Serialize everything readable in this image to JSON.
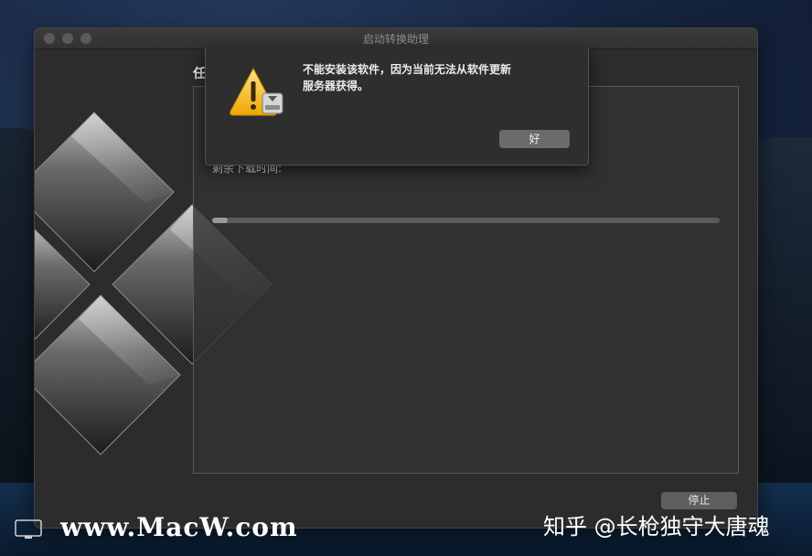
{
  "window": {
    "title": "启动转换助理",
    "heading_partial": "任",
    "remaining_label": "剩余下载时间:",
    "progress_fraction": 0.03,
    "stop_button": "停止"
  },
  "alert": {
    "message_line1": "不能安装该软件，因为当前无法从软件更新",
    "message_line2": "服务器获得。",
    "ok_button": "好",
    "icon": "warning-triangle-icon"
  },
  "watermarks": {
    "left": "www.MacW.com",
    "right": "知乎 @长枪独守大唐魂"
  }
}
